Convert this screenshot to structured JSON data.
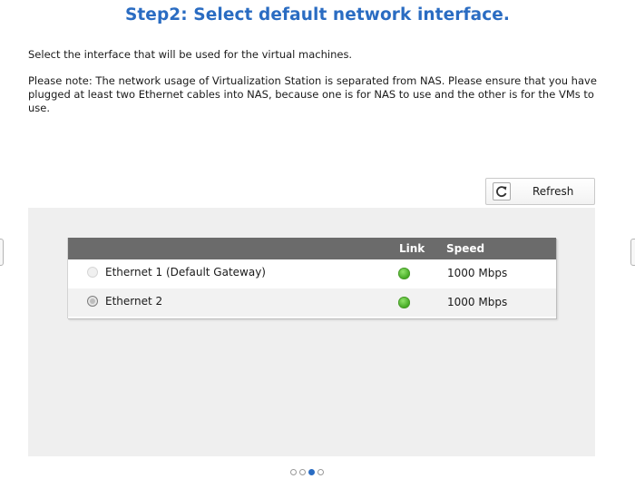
{
  "title": "Step2: Select default network interface.",
  "intro": "Select the interface that will be used for the virtual machines.",
  "note": "Please note: The network usage of Virtualization Station is separated from NAS. Please ensure that you have plugged at least two Ethernet cables into NAS, because one is for NAS to use and the other is for the VMs to use.",
  "refresh": {
    "label": "Refresh",
    "icon": "refresh-icon"
  },
  "table": {
    "columns": {
      "interface": "",
      "link": "Link",
      "speed": "Speed"
    },
    "rows": [
      {
        "interface": "Ethernet 1 (Default Gateway)",
        "link": "up",
        "speed": "1000 Mbps",
        "selectable": false
      },
      {
        "interface": "Ethernet 2",
        "link": "up",
        "speed": "1000 Mbps",
        "selectable": true
      }
    ],
    "link_color": "#3ea51d"
  },
  "pager": {
    "total": 4,
    "current": 3
  },
  "colors": {
    "accent": "#2a6cc2",
    "header_bg": "#6b6b6b",
    "panel_bg": "#efefef"
  }
}
